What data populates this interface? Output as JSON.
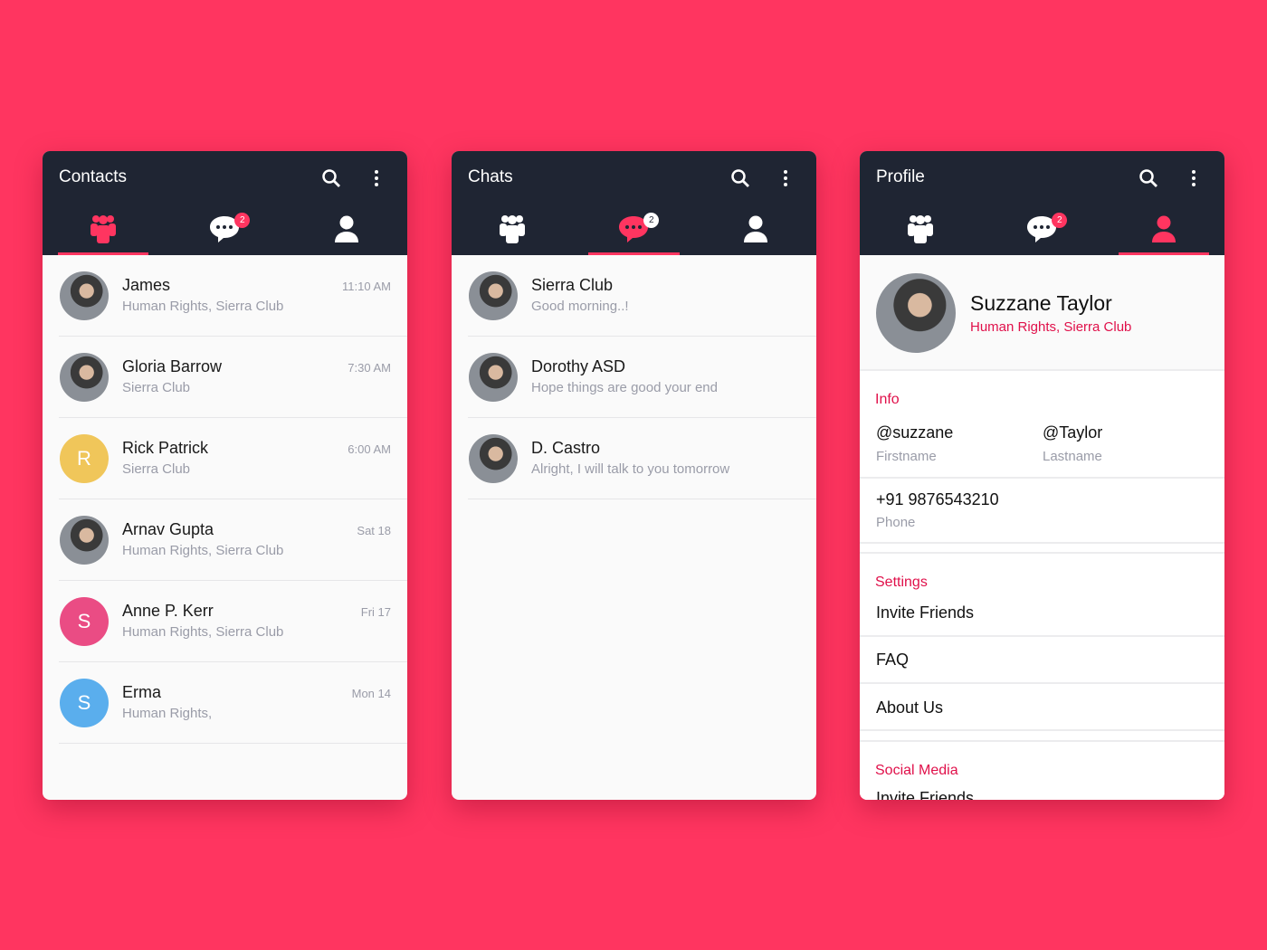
{
  "colors": {
    "background": "#ff3560",
    "header": "#1f2533",
    "accent": "#ff3560"
  },
  "contacts": {
    "title": "Contacts",
    "badge": "2",
    "items": [
      {
        "name": "James",
        "sub": "Human Rights, Sierra Club",
        "time": "11:10 AM",
        "avatar": "photo"
      },
      {
        "name": "Gloria Barrow",
        "sub": "Sierra Club",
        "time": "7:30 AM",
        "avatar": "photo"
      },
      {
        "name": "Rick Patrick",
        "sub": "Sierra Club",
        "time": "6:00 AM",
        "avatar": "R",
        "color": "#f0c65a"
      },
      {
        "name": "Arnav Gupta",
        "sub": "Human Rights, Sierra Club",
        "time": "Sat 18",
        "avatar": "photo"
      },
      {
        "name": "Anne P. Kerr",
        "sub": "Human Rights, Sierra Club",
        "time": "Fri 17",
        "avatar": "S",
        "color": "#ea4c84"
      },
      {
        "name": "Erma",
        "sub": "Human Rights,",
        "time": "Mon 14",
        "avatar": "S",
        "color": "#5aaeed"
      }
    ]
  },
  "chats": {
    "title": "Chats",
    "badge": "2",
    "items": [
      {
        "name": "Sierra Club",
        "sub": "Good morning..!"
      },
      {
        "name": "Dorothy ASD",
        "sub": "Hope things are good your end"
      },
      {
        "name": "D. Castro",
        "sub": "Alright, I will talk to you tomorrow"
      }
    ]
  },
  "profile": {
    "title": "Profile",
    "badge": "2",
    "name": "Suzzane Taylor",
    "groups": "Human Rights, Sierra Club",
    "info_label": "Info",
    "firstname": "@suzzane",
    "firstname_label": "Firstname",
    "lastname": "@Taylor",
    "lastname_label": "Lastname",
    "phone": "+91 9876543210",
    "phone_label": "Phone",
    "settings_label": "Settings",
    "settings": [
      "Invite Friends",
      "FAQ",
      "About Us"
    ],
    "social_label": "Social Media",
    "social_first": "Invite Friends"
  }
}
